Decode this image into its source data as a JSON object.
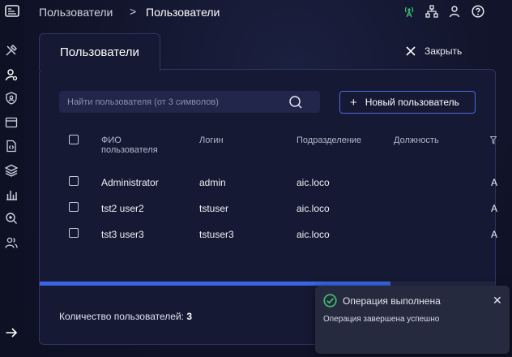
{
  "breadcrumb": {
    "parent": "Пользователи",
    "separator": ">",
    "current": "Пользователи"
  },
  "panel": {
    "title": "Пользователи",
    "close_label": "Закрыть",
    "search_placeholder": "Найти пользователя (от 3 символов)",
    "new_user_label": "Новый пользователь"
  },
  "table": {
    "headers": {
      "fio_line1": "ФИО",
      "fio_line2": "пользователя",
      "login": "Логин",
      "department": "Подразделение",
      "position": "Должность"
    },
    "rows": [
      {
        "fio": "Administrator",
        "login": "admin",
        "department": "aic.loco",
        "extra": "A"
      },
      {
        "fio": "tst2 user2",
        "login": "tstuser",
        "department": "aic.loco",
        "extra": "A"
      },
      {
        "fio": "tst3 user3",
        "login": "tstuser3",
        "department": "aic.loco",
        "extra": "A"
      }
    ],
    "scroll_position": 0.77
  },
  "footer": {
    "count_label": "Количество пользователей:",
    "count_value": "3"
  },
  "toast": {
    "title": "Операция выполнена",
    "message": "Операция завершена успешно",
    "close_glyph": "✕"
  },
  "colors": {
    "accent": "#3a66e6",
    "success": "#3ec46d",
    "antenna": "#3ec46d"
  },
  "icons": {
    "top": [
      "antenna-icon",
      "network-icon",
      "user-icon",
      "help-icon"
    ],
    "sidebar": [
      "tools-icon",
      "user-settings-icon",
      "shield-user-icon",
      "window-icon",
      "code-file-icon",
      "layers-icon",
      "bar-chart-icon",
      "search-zoom-icon",
      "users-icon",
      "arrow-right-icon"
    ]
  }
}
